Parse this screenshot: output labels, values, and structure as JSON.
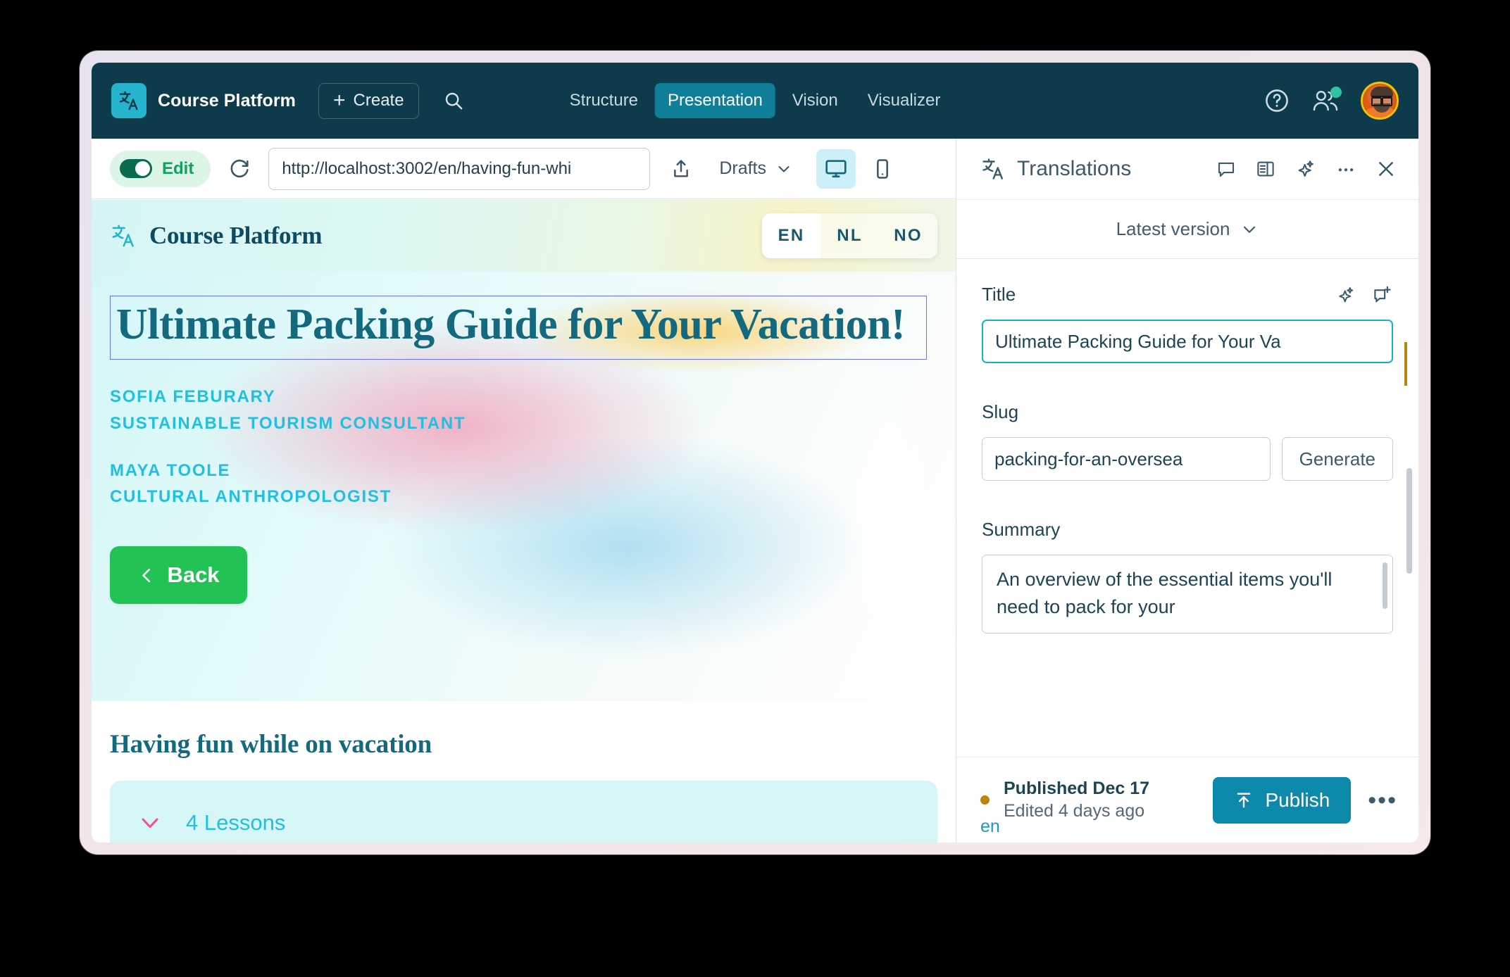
{
  "topbar": {
    "brand_name": "Course Platform",
    "logo_icon": "translate-icon",
    "create_label": "Create",
    "create_icon": "plus-icon",
    "search_icon": "search-icon",
    "tabs": [
      {
        "label": "Structure",
        "active": false
      },
      {
        "label": "Presentation",
        "active": true
      },
      {
        "label": "Vision",
        "active": false
      },
      {
        "label": "Visualizer",
        "active": false
      }
    ],
    "help_icon": "question-circle-icon",
    "presence_icon": "users-icon",
    "avatar_name": "avatar"
  },
  "preview_toolbar": {
    "edit_label": "Edit",
    "edit_enabled": true,
    "refresh_icon": "refresh-icon",
    "url_value": "http://localhost:3002/en/having-fun-whi",
    "share_icon": "share-icon",
    "drafts_label": "Drafts",
    "drafts_chevron": "chevron-down-icon",
    "desktop_icon": "desktop-icon",
    "mobile_icon": "mobile-icon",
    "active_view": "desktop"
  },
  "preview": {
    "site_name": "Course Platform",
    "site_logo_icon": "translate-icon",
    "languages": [
      {
        "code": "EN",
        "active": true
      },
      {
        "code": "NL",
        "active": false
      },
      {
        "code": "NO",
        "active": false
      }
    ],
    "hero_title": "Ultimate Packing Guide for Your Vacation!",
    "authors": [
      {
        "name": "SOFIA FEBURARY",
        "role": "SUSTAINABLE TOURISM CONSULTANT"
      },
      {
        "name": "MAYA TOOLE",
        "role": "CULTURAL ANTHROPOLOGIST"
      }
    ],
    "back_label": "Back",
    "back_icon": "chevron-left-icon",
    "section_title": "Having fun while on vacation",
    "lessons_label": "4 Lessons",
    "lessons_chevron": "chevron-down-icon"
  },
  "panel": {
    "title": "Translations",
    "title_icon": "translate-icon",
    "actions": [
      "comment-icon",
      "panel-layout-icon",
      "sparkle-icon",
      "more-horizontal-icon",
      "close-icon"
    ],
    "version_label": "Latest version",
    "version_chevron": "chevron-down-icon",
    "fields": {
      "title": {
        "label": "Title",
        "value": "Ultimate Packing Guide for Your Va",
        "icons": [
          "sparkle-icon",
          "add-comment-icon"
        ]
      },
      "slug": {
        "label": "Slug",
        "value": "packing-for-an-oversea",
        "generate_label": "Generate"
      },
      "summary": {
        "label": "Summary",
        "value": "An overview of the essential items you'll need to pack for your"
      }
    },
    "footer": {
      "status_line1": "Published Dec 17",
      "status_line2": "Edited 4 days ago",
      "publish_label": "Publish",
      "publish_icon": "publish-arrow-icon",
      "more_label": "•••",
      "lang_tag": "en"
    }
  },
  "colors": {
    "topbar_bg": "#0d3b4c",
    "accent_teal": "#0f7f99",
    "publish_blue": "#0d8aab",
    "edit_green": "#12a05f",
    "back_green": "#22c255",
    "author_cyan": "#21bfe0",
    "heading_teal": "#15697f",
    "status_dot": "#b8860b"
  }
}
